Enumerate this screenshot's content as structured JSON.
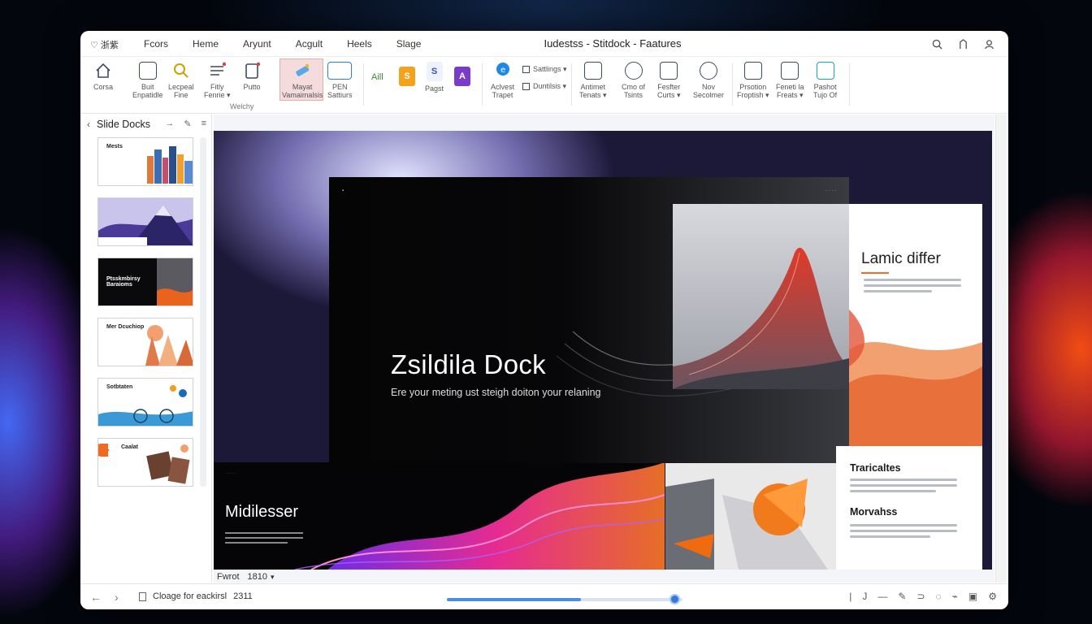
{
  "titlebar": {
    "app_badge": "♡ 浙紫",
    "menus": [
      "Fcors",
      "Heme",
      "Aryunt",
      "Acgult",
      "Heels",
      "Slage"
    ],
    "window_title": "Iudestss - Stitdock - Faatures"
  },
  "ribbon": {
    "buttons": [
      {
        "label": "Corsa"
      },
      {
        "label": "Buit\nEnpatidle"
      },
      {
        "label": "Lecpeal\nFine"
      },
      {
        "label": "Fitly\nFenrie ▾"
      },
      {
        "label": "Putto"
      },
      {
        "label": "Mayat\nVamaimalsis"
      },
      {
        "label": "PEN\nSattiurs"
      },
      {
        "label": "Aill"
      },
      {
        "label": "Pagst"
      },
      {
        "label": "Aclvest\nTrapet"
      },
      {
        "label": "Sattlings ▾"
      },
      {
        "label": "Duntilsis ▾"
      },
      {
        "label": "Antimet\nTenats ▾"
      },
      {
        "label": "Cmo of\nTsints"
      },
      {
        "label": "Fesfter\nCurts ▾"
      },
      {
        "label": "Nov\nSecolmer"
      },
      {
        "label": "Prsotion\nFroptish ▾"
      },
      {
        "label": "Feneti la\nFreats ▾"
      },
      {
        "label": "Pashot\nTujo Of"
      }
    ],
    "group_label": "Welchy"
  },
  "sidebar": {
    "title": "Slide Docks",
    "thumbnails": [
      {
        "label": "Mests"
      },
      {
        "label": ""
      },
      {
        "label": "Ptsskmbirsy\nBaraioms"
      },
      {
        "label": "Mer Dcuchiop"
      },
      {
        "label": "Sotbtaten"
      },
      {
        "label": "Caalat"
      }
    ]
  },
  "slide": {
    "title": "Zsildila Dock",
    "subtitle": "Ere your meting ust steigh doiton your relaning",
    "right_title": "Lamic differ",
    "bottom_title": "Midilesser",
    "card_heading_1": "Traricaltes",
    "card_heading_2": "Morvahss"
  },
  "zoom": {
    "label": "Fwrot",
    "value": "1810"
  },
  "statusbar": {
    "status_text": "Cloage for eackirsl",
    "status_number": "2311",
    "progress": 0.57
  }
}
